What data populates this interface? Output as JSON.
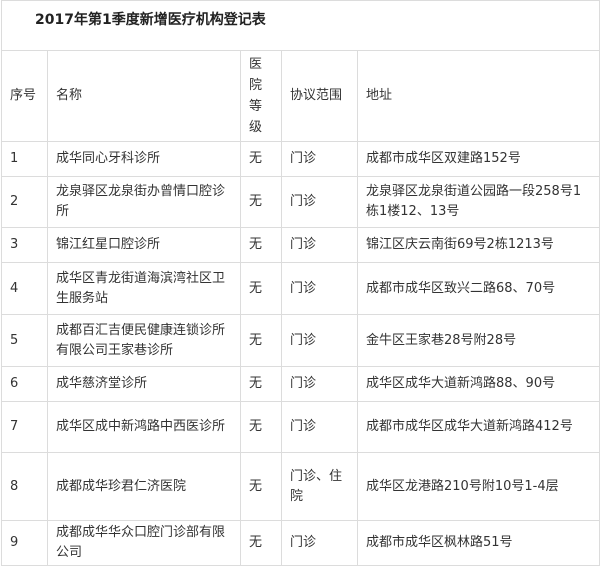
{
  "title": "2017年第1季度新增医疗机构登记表",
  "headers": {
    "no": "序号",
    "name": "名称",
    "level": "医院等级",
    "scope": "协议范围",
    "address": "地址"
  },
  "rows": [
    {
      "no": "1",
      "name": "成华同心牙科诊所",
      "level": "无",
      "scope": "门诊",
      "address": "成都市成华区双建路152号"
    },
    {
      "no": "2",
      "name": "龙泉驿区龙泉街办曾情口腔诊所",
      "level": "无",
      "scope": "门诊",
      "address": "龙泉驿区龙泉街道公园路一段258号1栋1楼12、13号"
    },
    {
      "no": "3",
      "name": "锦江红星口腔诊所",
      "level": "无",
      "scope": "门诊",
      "address": "锦江区庆云南街69号2栋1213号"
    },
    {
      "no": "4",
      "name": "成华区青龙街道海滨湾社区卫生服务站",
      "level": "无",
      "scope": "门诊",
      "address": "成都市成华区致兴二路68、70号"
    },
    {
      "no": "5",
      "name": "成都百汇吉便民健康连锁诊所有限公司王家巷诊所",
      "level": "无",
      "scope": "门诊",
      "address": "金牛区王家巷28号附28号"
    },
    {
      "no": "6",
      "name": "成华慈济堂诊所",
      "level": "无",
      "scope": "门诊",
      "address": "成华区成华大道新鸿路88、90号"
    },
    {
      "no": "7",
      "name": "成华区成中新鸿路中西医诊所",
      "level": "无",
      "scope": "门诊",
      "address": "成都市成华区成华大道新鸿路412号"
    },
    {
      "no": "8",
      "name": "成都成华珍君仁济医院",
      "level": "无",
      "scope": "门诊、住院",
      "address": "成华区龙港路210号附10号1-4层"
    },
    {
      "no": "9",
      "name": "成都成华华众口腔门诊部有限公司",
      "level": "无",
      "scope": "门诊",
      "address": "成都市成华区枫林路51号"
    }
  ]
}
